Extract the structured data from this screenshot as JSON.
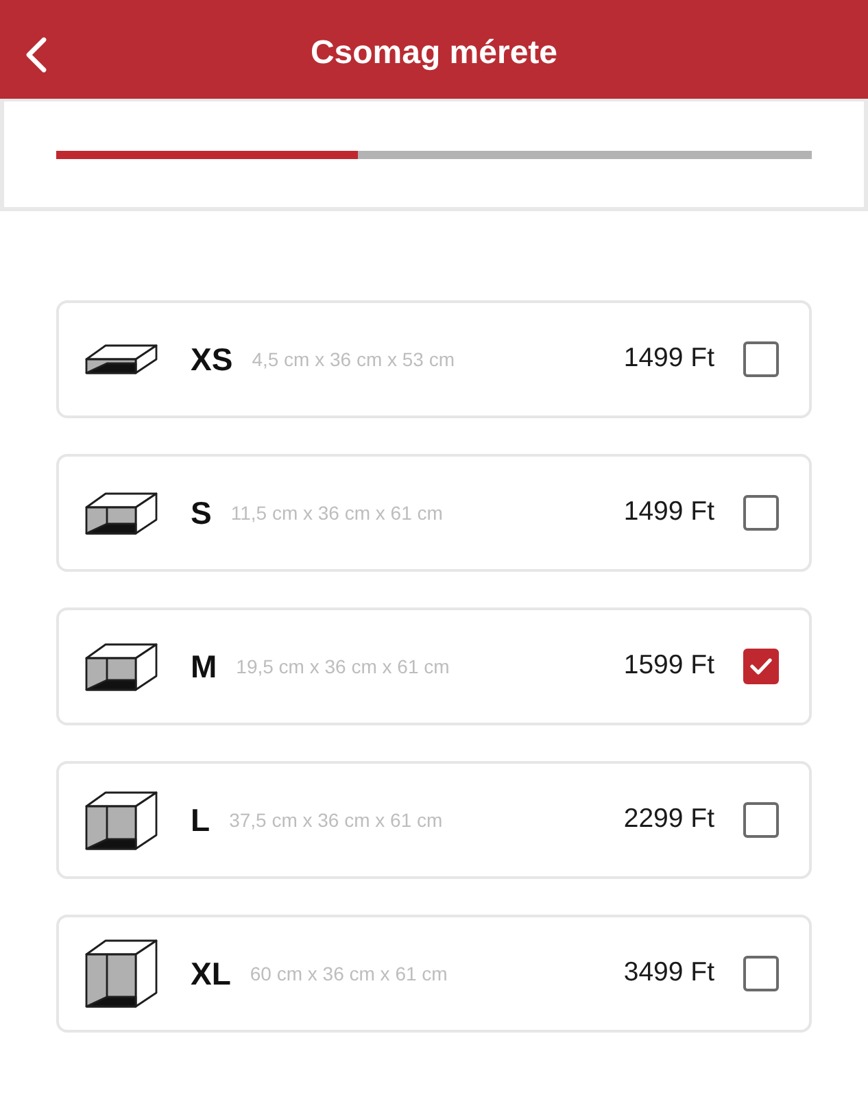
{
  "header": {
    "title": "Csomag mérete"
  },
  "progress": {
    "level": 0.4
  },
  "sizes": [
    {
      "label": "XS",
      "dimensions": "4,5 cm x 36 cm x 53 cm",
      "price": "1499 Ft",
      "selected": false
    },
    {
      "label": "S",
      "dimensions": "11,5 cm x 36 cm x 61 cm",
      "price": "1499 Ft",
      "selected": false
    },
    {
      "label": "M",
      "dimensions": "19,5 cm x 36 cm x 61 cm",
      "price": "1599 Ft",
      "selected": true
    },
    {
      "label": "L",
      "dimensions": "37,5 cm x 36 cm x 61 cm",
      "price": "2299 Ft",
      "selected": false
    },
    {
      "label": "XL",
      "dimensions": "60 cm x 36 cm x 61 cm",
      "price": "3499 Ft",
      "selected": false
    }
  ]
}
